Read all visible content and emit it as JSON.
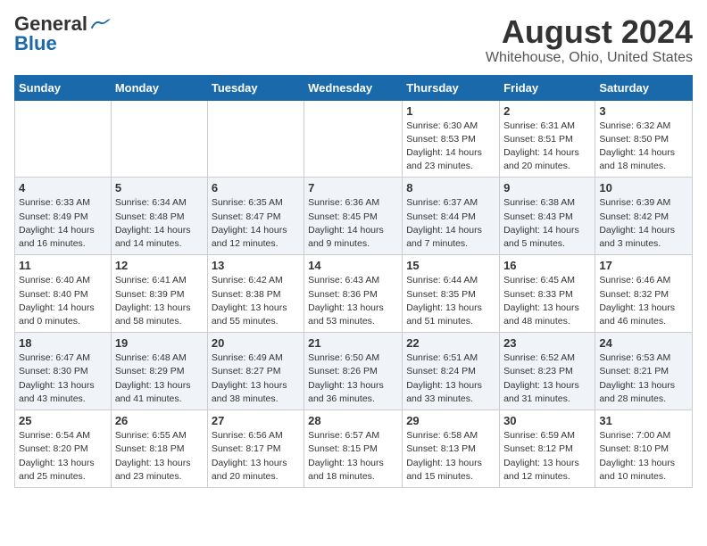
{
  "header": {
    "logo_general": "General",
    "logo_blue": "Blue",
    "main_title": "August 2024",
    "subtitle": "Whitehouse, Ohio, United States"
  },
  "days_of_week": [
    "Sunday",
    "Monday",
    "Tuesday",
    "Wednesday",
    "Thursday",
    "Friday",
    "Saturday"
  ],
  "weeks": [
    [
      {
        "num": "",
        "detail": ""
      },
      {
        "num": "",
        "detail": ""
      },
      {
        "num": "",
        "detail": ""
      },
      {
        "num": "",
        "detail": ""
      },
      {
        "num": "1",
        "detail": "Sunrise: 6:30 AM\nSunset: 8:53 PM\nDaylight: 14 hours\nand 23 minutes."
      },
      {
        "num": "2",
        "detail": "Sunrise: 6:31 AM\nSunset: 8:51 PM\nDaylight: 14 hours\nand 20 minutes."
      },
      {
        "num": "3",
        "detail": "Sunrise: 6:32 AM\nSunset: 8:50 PM\nDaylight: 14 hours\nand 18 minutes."
      }
    ],
    [
      {
        "num": "4",
        "detail": "Sunrise: 6:33 AM\nSunset: 8:49 PM\nDaylight: 14 hours\nand 16 minutes."
      },
      {
        "num": "5",
        "detail": "Sunrise: 6:34 AM\nSunset: 8:48 PM\nDaylight: 14 hours\nand 14 minutes."
      },
      {
        "num": "6",
        "detail": "Sunrise: 6:35 AM\nSunset: 8:47 PM\nDaylight: 14 hours\nand 12 minutes."
      },
      {
        "num": "7",
        "detail": "Sunrise: 6:36 AM\nSunset: 8:45 PM\nDaylight: 14 hours\nand 9 minutes."
      },
      {
        "num": "8",
        "detail": "Sunrise: 6:37 AM\nSunset: 8:44 PM\nDaylight: 14 hours\nand 7 minutes."
      },
      {
        "num": "9",
        "detail": "Sunrise: 6:38 AM\nSunset: 8:43 PM\nDaylight: 14 hours\nand 5 minutes."
      },
      {
        "num": "10",
        "detail": "Sunrise: 6:39 AM\nSunset: 8:42 PM\nDaylight: 14 hours\nand 3 minutes."
      }
    ],
    [
      {
        "num": "11",
        "detail": "Sunrise: 6:40 AM\nSunset: 8:40 PM\nDaylight: 14 hours\nand 0 minutes."
      },
      {
        "num": "12",
        "detail": "Sunrise: 6:41 AM\nSunset: 8:39 PM\nDaylight: 13 hours\nand 58 minutes."
      },
      {
        "num": "13",
        "detail": "Sunrise: 6:42 AM\nSunset: 8:38 PM\nDaylight: 13 hours\nand 55 minutes."
      },
      {
        "num": "14",
        "detail": "Sunrise: 6:43 AM\nSunset: 8:36 PM\nDaylight: 13 hours\nand 53 minutes."
      },
      {
        "num": "15",
        "detail": "Sunrise: 6:44 AM\nSunset: 8:35 PM\nDaylight: 13 hours\nand 51 minutes."
      },
      {
        "num": "16",
        "detail": "Sunrise: 6:45 AM\nSunset: 8:33 PM\nDaylight: 13 hours\nand 48 minutes."
      },
      {
        "num": "17",
        "detail": "Sunrise: 6:46 AM\nSunset: 8:32 PM\nDaylight: 13 hours\nand 46 minutes."
      }
    ],
    [
      {
        "num": "18",
        "detail": "Sunrise: 6:47 AM\nSunset: 8:30 PM\nDaylight: 13 hours\nand 43 minutes."
      },
      {
        "num": "19",
        "detail": "Sunrise: 6:48 AM\nSunset: 8:29 PM\nDaylight: 13 hours\nand 41 minutes."
      },
      {
        "num": "20",
        "detail": "Sunrise: 6:49 AM\nSunset: 8:27 PM\nDaylight: 13 hours\nand 38 minutes."
      },
      {
        "num": "21",
        "detail": "Sunrise: 6:50 AM\nSunset: 8:26 PM\nDaylight: 13 hours\nand 36 minutes."
      },
      {
        "num": "22",
        "detail": "Sunrise: 6:51 AM\nSunset: 8:24 PM\nDaylight: 13 hours\nand 33 minutes."
      },
      {
        "num": "23",
        "detail": "Sunrise: 6:52 AM\nSunset: 8:23 PM\nDaylight: 13 hours\nand 31 minutes."
      },
      {
        "num": "24",
        "detail": "Sunrise: 6:53 AM\nSunset: 8:21 PM\nDaylight: 13 hours\nand 28 minutes."
      }
    ],
    [
      {
        "num": "25",
        "detail": "Sunrise: 6:54 AM\nSunset: 8:20 PM\nDaylight: 13 hours\nand 25 minutes."
      },
      {
        "num": "26",
        "detail": "Sunrise: 6:55 AM\nSunset: 8:18 PM\nDaylight: 13 hours\nand 23 minutes."
      },
      {
        "num": "27",
        "detail": "Sunrise: 6:56 AM\nSunset: 8:17 PM\nDaylight: 13 hours\nand 20 minutes."
      },
      {
        "num": "28",
        "detail": "Sunrise: 6:57 AM\nSunset: 8:15 PM\nDaylight: 13 hours\nand 18 minutes."
      },
      {
        "num": "29",
        "detail": "Sunrise: 6:58 AM\nSunset: 8:13 PM\nDaylight: 13 hours\nand 15 minutes."
      },
      {
        "num": "30",
        "detail": "Sunrise: 6:59 AM\nSunset: 8:12 PM\nDaylight: 13 hours\nand 12 minutes."
      },
      {
        "num": "31",
        "detail": "Sunrise: 7:00 AM\nSunset: 8:10 PM\nDaylight: 13 hours\nand 10 minutes."
      }
    ]
  ]
}
